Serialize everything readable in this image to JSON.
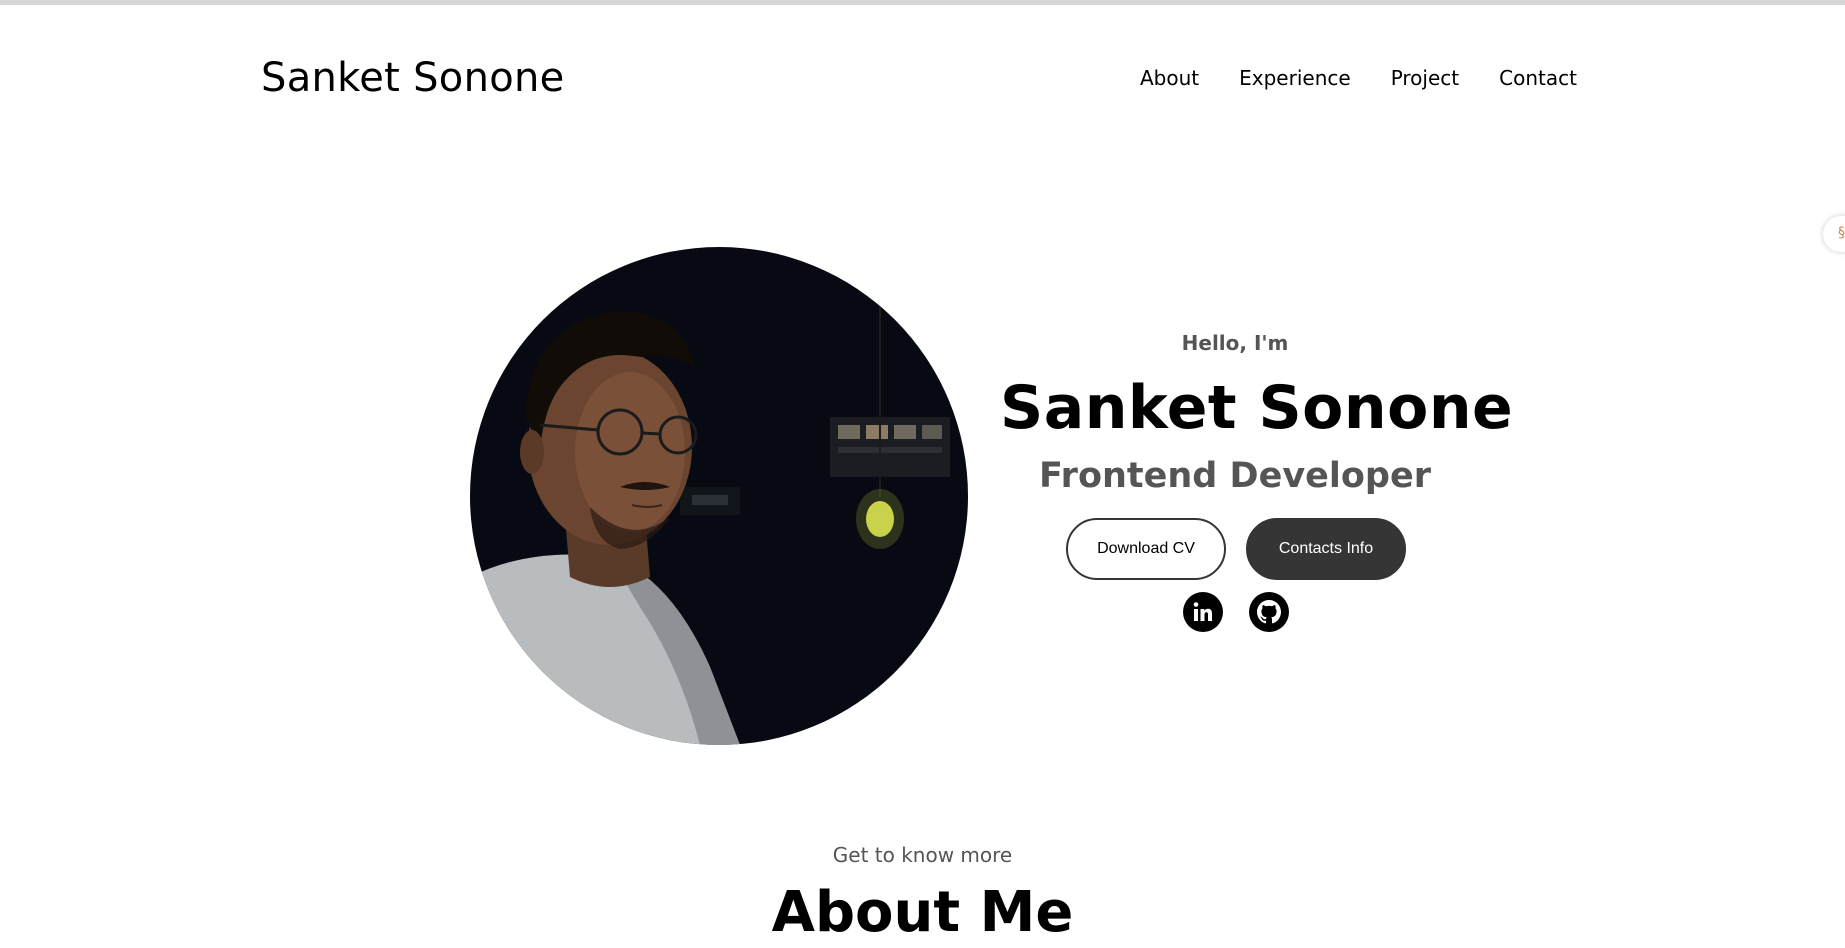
{
  "nav": {
    "logo": "Sanket Sonone",
    "links": [
      "About",
      "Experience",
      "Project",
      "Contact"
    ]
  },
  "hero": {
    "greeting": "Hello, I'm",
    "name": "Sanket Sonone",
    "role": "Frontend Developer",
    "download_label": "Download CV",
    "contact_label": "Contacts Info",
    "socials": [
      "linkedin-icon",
      "github-icon"
    ]
  },
  "about": {
    "subtitle": "Get to know more",
    "title": "About Me"
  },
  "colors": {
    "button_dark": "#353535",
    "muted_text": "#555555"
  }
}
